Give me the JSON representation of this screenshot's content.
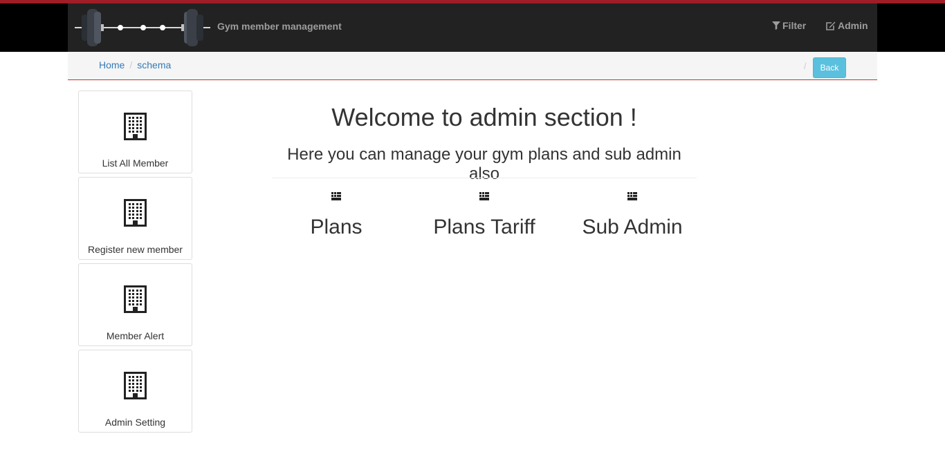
{
  "header": {
    "brand_name": "Gym member management",
    "logo": "barbell-logo",
    "nav": [
      {
        "label": "Filter",
        "icon": "filter-icon"
      },
      {
        "label": "Admin",
        "icon": "edit-icon"
      }
    ]
  },
  "breadcrumb": {
    "items": [
      "Home",
      "schema"
    ],
    "back_label": "Back"
  },
  "sidebar": {
    "items": [
      {
        "label": "List All Member",
        "icon": "building-icon"
      },
      {
        "label": "Register new member",
        "icon": "building-icon"
      },
      {
        "label": "Member Alert",
        "icon": "building-icon"
      },
      {
        "label": "Admin Setting",
        "icon": "building-icon"
      }
    ]
  },
  "main": {
    "title": "Welcome to admin section !",
    "subtitle": "Here you can manage your gym plans and sub admin also",
    "tiles": [
      {
        "label": "Plans",
        "icon": "grid-icon"
      },
      {
        "label": "Plans Tariff",
        "icon": "grid-icon"
      },
      {
        "label": "Sub Admin",
        "icon": "grid-icon"
      }
    ]
  },
  "colors": {
    "top_strip": "#9e1d26",
    "navbar": "#222222",
    "nav_text": "#9d9d9d",
    "link": "#337ab7",
    "back_button": "#5bc0de",
    "breadcrumb_border": "#c9302c"
  }
}
